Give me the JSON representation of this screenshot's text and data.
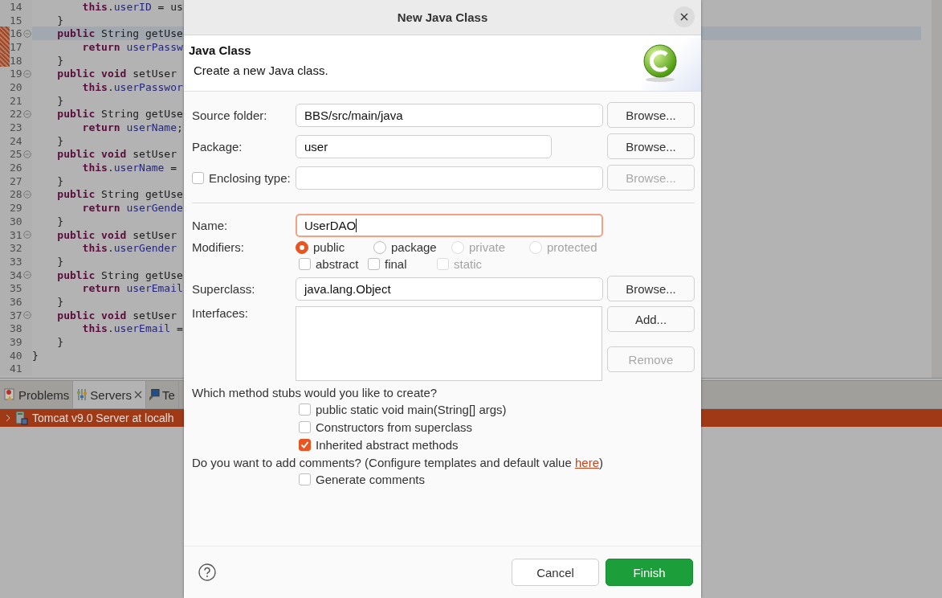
{
  "editor": {
    "lines": [
      {
        "number": "14",
        "foldable": false,
        "current": false,
        "marker": false,
        "code": [
          {
            "text": "        this",
            "kind": "keyword"
          },
          {
            "text": "."
          },
          {
            "text": "userID",
            "kind": "field"
          },
          {
            "text": " = us"
          }
        ]
      },
      {
        "number": "15",
        "foldable": false,
        "current": false,
        "marker": false,
        "code": [
          {
            "text": "    }"
          }
        ]
      },
      {
        "number": "16",
        "foldable": true,
        "current": true,
        "marker": true,
        "code": [
          {
            "text": "    public",
            "kind": "keyword"
          },
          {
            "text": " String getUse"
          }
        ]
      },
      {
        "number": "17",
        "foldable": false,
        "current": false,
        "marker": true,
        "code": [
          {
            "text": "        return ",
            "kind": "keyword"
          },
          {
            "text": "userPassw",
            "kind": "field"
          }
        ]
      },
      {
        "number": "18",
        "foldable": false,
        "current": false,
        "marker": true,
        "code": [
          {
            "text": "    }"
          }
        ]
      },
      {
        "number": "19",
        "foldable": true,
        "current": false,
        "marker": false,
        "code": [
          {
            "text": "    public void",
            "kind": "keyword"
          },
          {
            "text": " setUser"
          }
        ]
      },
      {
        "number": "20",
        "foldable": false,
        "current": false,
        "marker": false,
        "code": [
          {
            "text": "        this",
            "kind": "keyword"
          },
          {
            "text": "."
          },
          {
            "text": "userPasswor",
            "kind": "field"
          }
        ]
      },
      {
        "number": "21",
        "foldable": false,
        "current": false,
        "marker": false,
        "code": [
          {
            "text": "    }"
          }
        ]
      },
      {
        "number": "22",
        "foldable": true,
        "current": false,
        "marker": false,
        "code": [
          {
            "text": "    public",
            "kind": "keyword"
          },
          {
            "text": " String getUse"
          }
        ]
      },
      {
        "number": "23",
        "foldable": false,
        "current": false,
        "marker": false,
        "code": [
          {
            "text": "        return ",
            "kind": "keyword"
          },
          {
            "text": "userName",
            "kind": "field"
          },
          {
            "text": ";"
          }
        ]
      },
      {
        "number": "24",
        "foldable": false,
        "current": false,
        "marker": false,
        "code": [
          {
            "text": "    }"
          }
        ]
      },
      {
        "number": "25",
        "foldable": true,
        "current": false,
        "marker": false,
        "code": [
          {
            "text": "    public void",
            "kind": "keyword"
          },
          {
            "text": " setUser"
          }
        ]
      },
      {
        "number": "26",
        "foldable": false,
        "current": false,
        "marker": false,
        "code": [
          {
            "text": "        this",
            "kind": "keyword"
          },
          {
            "text": "."
          },
          {
            "text": "userName",
            "kind": "field"
          },
          {
            "text": " ="
          }
        ]
      },
      {
        "number": "27",
        "foldable": false,
        "current": false,
        "marker": false,
        "code": [
          {
            "text": "    }"
          }
        ]
      },
      {
        "number": "28",
        "foldable": true,
        "current": false,
        "marker": false,
        "code": [
          {
            "text": "    public",
            "kind": "keyword"
          },
          {
            "text": " String getUse"
          }
        ]
      },
      {
        "number": "29",
        "foldable": false,
        "current": false,
        "marker": false,
        "code": [
          {
            "text": "        return ",
            "kind": "keyword"
          },
          {
            "text": "userGende",
            "kind": "field"
          }
        ]
      },
      {
        "number": "30",
        "foldable": false,
        "current": false,
        "marker": false,
        "code": [
          {
            "text": "    }"
          }
        ]
      },
      {
        "number": "31",
        "foldable": true,
        "current": false,
        "marker": false,
        "code": [
          {
            "text": "    public void",
            "kind": "keyword"
          },
          {
            "text": " setUser"
          }
        ]
      },
      {
        "number": "32",
        "foldable": false,
        "current": false,
        "marker": false,
        "code": [
          {
            "text": "        this",
            "kind": "keyword"
          },
          {
            "text": "."
          },
          {
            "text": "userGender",
            "kind": "field"
          }
        ]
      },
      {
        "number": "33",
        "foldable": false,
        "current": false,
        "marker": false,
        "code": [
          {
            "text": "    }"
          }
        ]
      },
      {
        "number": "34",
        "foldable": true,
        "current": false,
        "marker": false,
        "code": [
          {
            "text": "    public",
            "kind": "keyword"
          },
          {
            "text": " String getUse"
          }
        ]
      },
      {
        "number": "35",
        "foldable": false,
        "current": false,
        "marker": false,
        "code": [
          {
            "text": "        return ",
            "kind": "keyword"
          },
          {
            "text": "userEmail",
            "kind": "field"
          }
        ]
      },
      {
        "number": "36",
        "foldable": false,
        "current": false,
        "marker": false,
        "code": [
          {
            "text": "    }"
          }
        ]
      },
      {
        "number": "37",
        "foldable": true,
        "current": false,
        "marker": false,
        "code": [
          {
            "text": "    public void",
            "kind": "keyword"
          },
          {
            "text": " setUser"
          }
        ]
      },
      {
        "number": "38",
        "foldable": false,
        "current": false,
        "marker": false,
        "code": [
          {
            "text": "        this",
            "kind": "keyword"
          },
          {
            "text": "."
          },
          {
            "text": "userEmail",
            "kind": "field"
          },
          {
            "text": " ="
          }
        ]
      },
      {
        "number": "39",
        "foldable": false,
        "current": false,
        "marker": false,
        "code": [
          {
            "text": "    }"
          }
        ]
      },
      {
        "number": "40",
        "foldable": false,
        "current": false,
        "marker": false,
        "code": [
          {
            "text": "}"
          }
        ]
      },
      {
        "number": "41",
        "foldable": false,
        "current": false,
        "marker": false
      }
    ]
  },
  "panel": {
    "tabs": [
      {
        "label": "Problems",
        "kind": "problems",
        "selected": false,
        "closable": false
      },
      {
        "label": "Servers",
        "kind": "servers",
        "selected": true,
        "closable": true
      },
      {
        "label": "Te",
        "kind": "terminal",
        "selected": false,
        "closable": false
      }
    ],
    "servers": [
      {
        "label": "Tomcat v9.0 Server at localh",
        "selected": true,
        "expanded": false
      }
    ]
  },
  "dialog": {
    "title": "New Java Class",
    "header": {
      "title": "Java Class",
      "description": "Create a new Java class."
    },
    "source_folder": {
      "label": "Source folder:",
      "value": "BBS/src/main/java",
      "button": {
        "label": "Browse...",
        "disabled": false
      }
    },
    "package": {
      "label": "Package:",
      "value": "user",
      "button": {
        "label": "Browse...",
        "disabled": false
      }
    },
    "enclosing_type": {
      "label": "Enclosing type:",
      "checked": false,
      "button": {
        "label": "Browse...",
        "disabled": true
      }
    },
    "name": {
      "label": "Name:",
      "value": "UserDAO",
      "focused": true
    },
    "modifiers": {
      "label": "Modifiers:",
      "access": [
        {
          "label": "public",
          "selected": true,
          "disabled": false
        },
        {
          "label": "package",
          "selected": false,
          "disabled": false
        },
        {
          "label": "private",
          "selected": false,
          "disabled": true
        },
        {
          "label": "protected",
          "selected": false,
          "disabled": true
        }
      ],
      "flags": [
        {
          "label": "abstract",
          "checked": false,
          "disabled": false
        },
        {
          "label": "final",
          "checked": false,
          "disabled": false
        },
        {
          "label": "static",
          "checked": false,
          "disabled": true
        }
      ]
    },
    "superclass": {
      "label": "Superclass:",
      "value": "java.lang.Object",
      "button": {
        "label": "Browse...",
        "disabled": false
      }
    },
    "interfaces": {
      "label": "Interfaces:",
      "buttons": [
        {
          "label": "Add...",
          "disabled": false
        },
        {
          "label": "Remove",
          "disabled": true
        }
      ]
    },
    "stubs": {
      "question": "Which method stubs would you like to create?",
      "options": [
        {
          "label": "public static void main(String[] args)",
          "checked": false
        },
        {
          "label": "Constructors from superclass",
          "checked": false
        },
        {
          "label": "Inherited abstract methods",
          "checked": true
        }
      ]
    },
    "comments": {
      "text": "Do you want to add comments? (Configure templates and default value ",
      "link": "here",
      "text_after": ")",
      "option": {
        "label": "Generate comments",
        "checked": false
      }
    },
    "buttons": [
      {
        "label": "Cancel",
        "kind": "secondary"
      },
      {
        "label": "Finish",
        "kind": "primary"
      }
    ]
  }
}
